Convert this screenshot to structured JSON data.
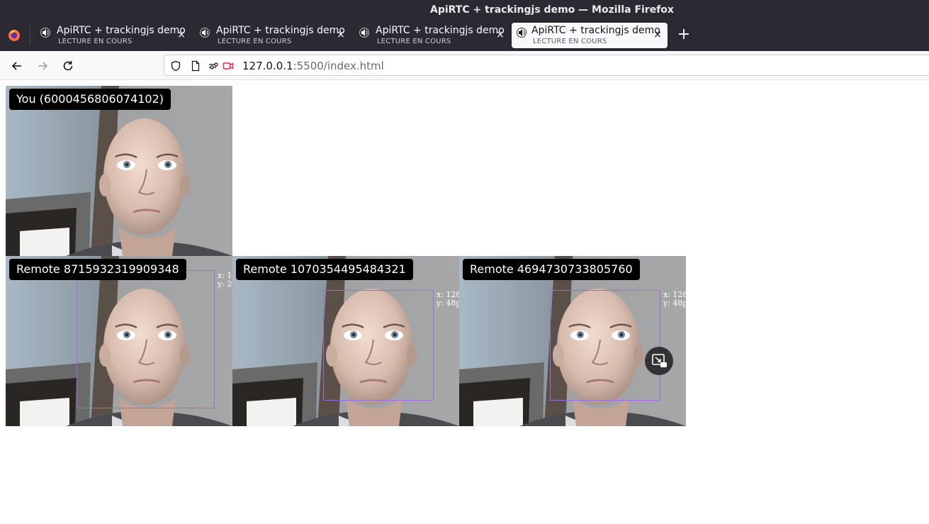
{
  "window": {
    "title": "ApiRTC + trackingjs demo — Mozilla Firefox"
  },
  "tabs": [
    {
      "title": "ApiRTC + trackingjs demo",
      "subtitle": "LECTURE EN COURS",
      "active": false
    },
    {
      "title": "ApiRTC + trackingjs demo",
      "subtitle": "LECTURE EN COURS",
      "active": false
    },
    {
      "title": "ApiRTC + trackingjs demo",
      "subtitle": "LECTURE EN COURS",
      "active": false
    },
    {
      "title": "ApiRTC + trackingjs demo",
      "subtitle": "LECTURE EN COURS",
      "active": true
    }
  ],
  "tab_close_glyph": "×",
  "new_tab_glyph": "+",
  "toolbar": {
    "back_icon": "back-arrow-icon",
    "forward_icon": "forward-arrow-icon",
    "reload_icon": "reload-icon"
  },
  "urlbar": {
    "host": "127.0.0.1",
    "rest": ":5500/index.html"
  },
  "local_video": {
    "label": "You (6000456806074102)"
  },
  "remote_videos": [
    {
      "label": "Remote 8715932319909348",
      "info_x": "x: 1",
      "info_y": "y: 2"
    },
    {
      "label": "Remote 1070354495484321",
      "info_x": "x: 128",
      "info_y": "y: 48p"
    },
    {
      "label": "Remote 4694730733805760",
      "info_x": "x: 128",
      "info_y": "y: 48p"
    }
  ],
  "colors": {
    "track_box": "#a06ad8",
    "tab_bg": "#2b2a33",
    "active_tab_bg": "#f9f9fb",
    "record_icon": "#e22850"
  }
}
